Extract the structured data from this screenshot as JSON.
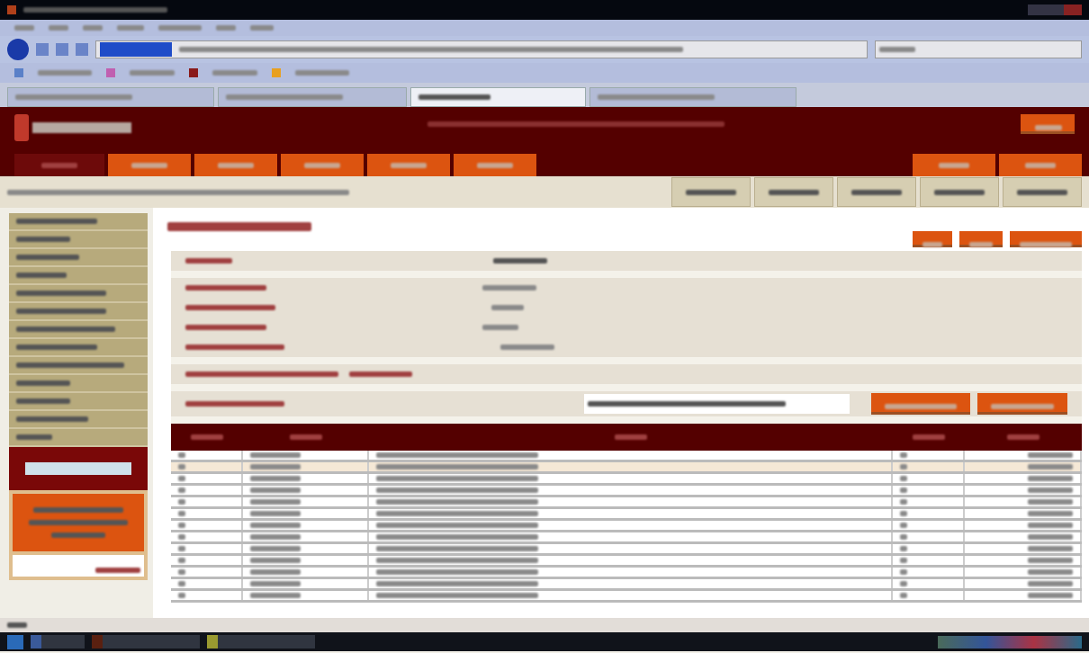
{
  "browser": {
    "tabs": [
      {
        "selected": false
      },
      {
        "selected": false
      },
      {
        "selected": true
      },
      {
        "selected": false
      }
    ]
  },
  "site_nav": {
    "tabs": [
      {
        "selected": true
      },
      {
        "selected": false
      },
      {
        "selected": false
      },
      {
        "selected": false
      },
      {
        "selected": false
      },
      {
        "selected": false
      }
    ],
    "right_tabs": [
      {
        "selected": false
      },
      {
        "selected": false
      }
    ]
  },
  "sidebar": {
    "items": [
      {
        "kind": "link"
      },
      {
        "kind": "link"
      },
      {
        "kind": "link"
      },
      {
        "kind": "link"
      },
      {
        "kind": "link"
      },
      {
        "kind": "link"
      },
      {
        "kind": "link"
      },
      {
        "kind": "link"
      },
      {
        "kind": "link"
      },
      {
        "kind": "link"
      },
      {
        "kind": "link"
      },
      {
        "kind": "link"
      },
      {
        "kind": "link"
      }
    ]
  },
  "account_panel": {
    "rows": [
      {
        "kind": "header"
      },
      {
        "kind": "field"
      },
      {
        "kind": "field"
      },
      {
        "kind": "field"
      },
      {
        "kind": "field"
      },
      {
        "kind": "total"
      },
      {
        "kind": "search"
      }
    ]
  },
  "table": {
    "columns": [
      {
        "kind": "narrow"
      },
      {
        "kind": "date"
      },
      {
        "kind": "wide"
      },
      {
        "kind": "narrow"
      },
      {
        "kind": "amount"
      }
    ],
    "rows": [
      {
        "selected": false
      },
      {
        "selected": true
      },
      {
        "selected": false
      },
      {
        "selected": false
      },
      {
        "selected": false
      },
      {
        "selected": false
      },
      {
        "selected": false
      },
      {
        "selected": false
      },
      {
        "selected": false
      },
      {
        "selected": false
      },
      {
        "selected": false
      },
      {
        "selected": false
      },
      {
        "selected": false
      }
    ]
  }
}
